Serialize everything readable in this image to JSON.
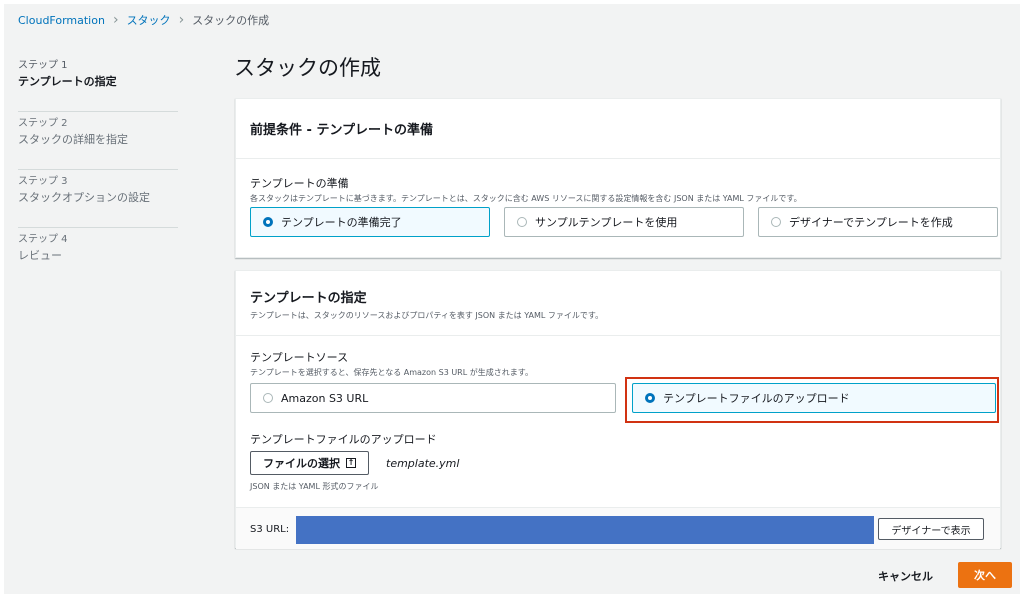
{
  "breadcrumb": {
    "items": [
      "CloudFormation",
      "スタック",
      "スタックの作成"
    ]
  },
  "steps": [
    {
      "num": "ステップ 1",
      "name": "テンプレートの指定",
      "active": true
    },
    {
      "num": "ステップ 2",
      "name": "スタックの詳細を指定",
      "active": false
    },
    {
      "num": "ステップ 3",
      "name": "スタックオプションの設定",
      "active": false
    },
    {
      "num": "ステップ 4",
      "name": "レビュー",
      "active": false
    }
  ],
  "page_title": "スタックの作成",
  "prereq": {
    "title": "前提条件 - テンプレートの準備",
    "label": "テンプレートの準備",
    "description": "各スタックはテンプレートに基づきます。テンプレートとは、スタックに含む AWS リソースに関する設定情報を含む JSON または YAML ファイルです。",
    "options": [
      {
        "label": "テンプレートの準備完了",
        "selected": true
      },
      {
        "label": "サンプルテンプレートを使用",
        "selected": false
      },
      {
        "label": "デザイナーでテンプレートを作成",
        "selected": false
      }
    ]
  },
  "spec": {
    "title": "テンプレートの指定",
    "description": "テンプレートは、スタックのリソースおよびプロパティを表す JSON または YAML ファイルです。",
    "source_label": "テンプレートソース",
    "source_description": "テンプレートを選択すると、保存先となる Amazon S3 URL が生成されます。",
    "source_options": [
      {
        "label": "Amazon S3 URL",
        "selected": false
      },
      {
        "label": "テンプレートファイルのアップロード",
        "selected": true
      }
    ],
    "upload_label": "テンプレートファイルのアップロード",
    "choose_file_label": "ファイルの選択",
    "file_name": "template.yml",
    "file_hint": "JSON または YAML 形式のファイル",
    "s3_url_label": "S3 URL:",
    "designer_button": "デザイナーで表示"
  },
  "footer": {
    "cancel": "キャンセル",
    "next": "次へ"
  },
  "colors": {
    "accent": "#0073bb",
    "primary_button": "#ec7211",
    "redacted_fill": "#4472c4",
    "highlight": "#d13212"
  }
}
